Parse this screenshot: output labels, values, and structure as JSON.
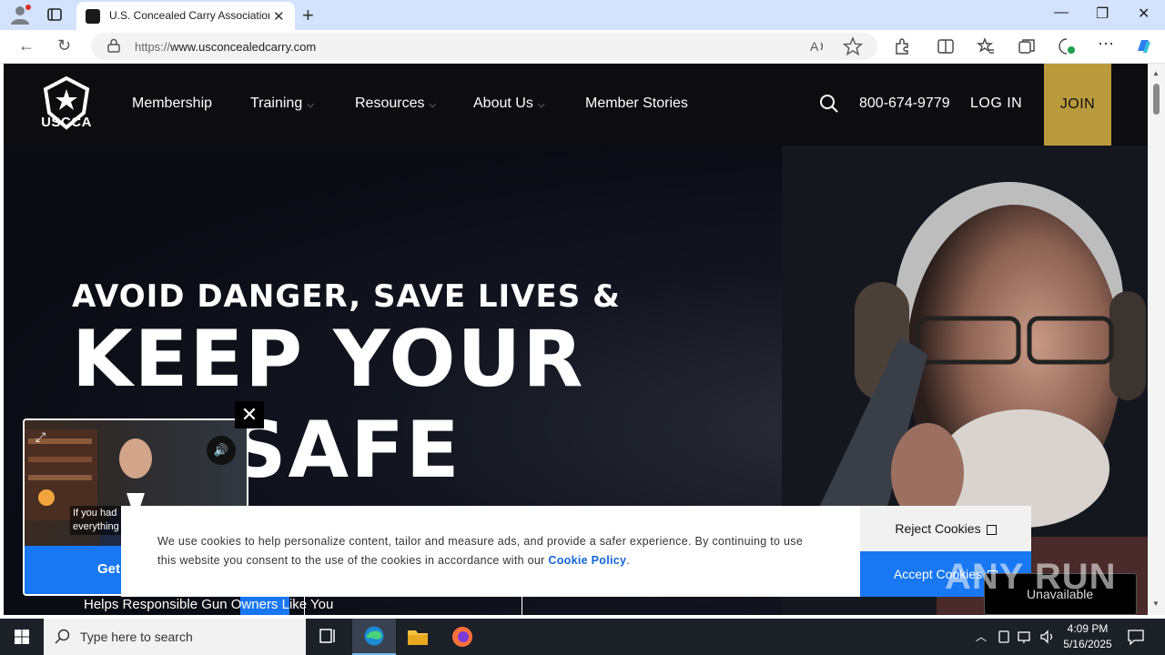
{
  "browser": {
    "tab_title": "U.S. Concealed Carry Association",
    "url_prefix": "https://",
    "url_host": "www.usconcealedcarry.com"
  },
  "site": {
    "logo_text": "USCCA",
    "nav": {
      "membership": "Membership",
      "training": "Training",
      "resources": "Resources",
      "about": "About Us",
      "stories": "Member Stories"
    },
    "phone": "800-674-9779",
    "login": "LOG IN",
    "join": "JOIN"
  },
  "hero": {
    "subtitle": "AVOID DANGER, SAVE LIVES &",
    "title_line1": "KEEP YOUR",
    "title_line2": "ILY SAFE",
    "tagline": "Helps Responsible Gun Owners Like You"
  },
  "video_popup": {
    "caption_line1": "If you had",
    "caption_line2": "everything",
    "cta": "Get"
  },
  "cookie": {
    "text": "We use cookies to help personalize content, tailor and measure ads, and provide a safer experience. By continuing to use this website you consent to the use of the cookies in accordance with our",
    "link": "Cookie Policy",
    "after": ".",
    "reject": "Reject Cookies",
    "accept": "Accept Cookies"
  },
  "overlay": {
    "unavailable": "Unavailable",
    "watermark": "ANY RUN"
  },
  "taskbar": {
    "search_placeholder": "Type here to search",
    "time": "4:09 PM",
    "date": "5/16/2025"
  },
  "colors": {
    "join_gold": "#b99a3c",
    "accent_blue": "#1877f2",
    "header_bg": "#0d0d0f"
  }
}
